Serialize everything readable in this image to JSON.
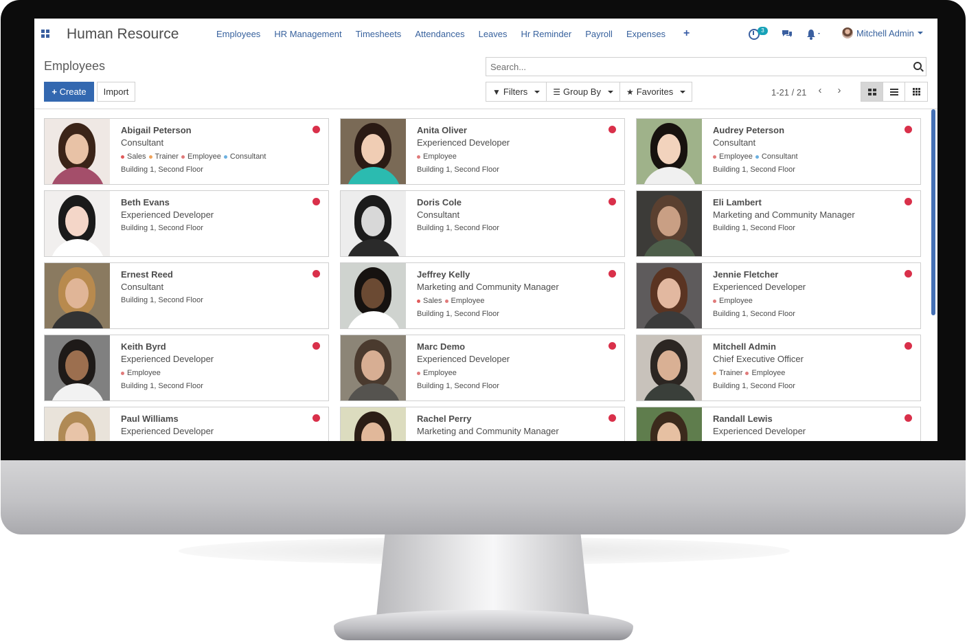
{
  "app": {
    "brand": "Human Resource",
    "menu": [
      "Employees",
      "HR Management",
      "Timesheets",
      "Attendances",
      "Leaves",
      "Hr Reminder",
      "Payroll",
      "Expenses"
    ],
    "add_menu_glyph": "+",
    "activity_count": "3",
    "user_name": "Mitchell Admin"
  },
  "control_panel": {
    "breadcrumb": "Employees",
    "create_label": "Create",
    "import_label": "Import",
    "search_placeholder": "Search...",
    "filters_label": "Filters",
    "group_by_label": "Group By",
    "favorites_label": "Favorites",
    "pager": "1-21 / 21",
    "active_view": "kanban"
  },
  "tag_colors": {
    "Sales": "#e15a5a",
    "Trainer": "#f0a35a",
    "Employee": "#e07a7a",
    "Consultant": "#6bb0e0"
  },
  "status_color": "#d9304a",
  "employees": [
    {
      "name": "Abigail Peterson",
      "job": "Consultant",
      "tags": [
        "Sales",
        "Trainer",
        "Employee",
        "Consultant"
      ],
      "location": "Building 1, Second Floor"
    },
    {
      "name": "Anita Oliver",
      "job": "Experienced Developer",
      "tags": [
        "Employee"
      ],
      "location": "Building 1, Second Floor"
    },
    {
      "name": "Audrey Peterson",
      "job": "Consultant",
      "tags": [
        "Employee",
        "Consultant"
      ],
      "location": "Building 1, Second Floor"
    },
    {
      "name": "Beth Evans",
      "job": "Experienced Developer",
      "tags": [],
      "location": "Building 1, Second Floor"
    },
    {
      "name": "Doris Cole",
      "job": "Consultant",
      "tags": [],
      "location": "Building 1, Second Floor"
    },
    {
      "name": "Eli Lambert",
      "job": "Marketing and Community Manager",
      "tags": [],
      "location": "Building 1, Second Floor"
    },
    {
      "name": "Ernest Reed",
      "job": "Consultant",
      "tags": [],
      "location": "Building 1, Second Floor"
    },
    {
      "name": "Jeffrey Kelly",
      "job": "Marketing and Community Manager",
      "tags": [
        "Sales",
        "Employee"
      ],
      "location": "Building 1, Second Floor"
    },
    {
      "name": "Jennie Fletcher",
      "job": "Experienced Developer",
      "tags": [
        "Employee"
      ],
      "location": "Building 1, Second Floor"
    },
    {
      "name": "Keith Byrd",
      "job": "Experienced Developer",
      "tags": [
        "Employee"
      ],
      "location": "Building 1, Second Floor"
    },
    {
      "name": "Marc Demo",
      "job": "Experienced Developer",
      "tags": [
        "Employee"
      ],
      "location": "Building 1, Second Floor"
    },
    {
      "name": "Mitchell Admin",
      "job": "Chief Executive Officer",
      "tags": [
        "Trainer",
        "Employee"
      ],
      "location": "Building 1, Second Floor"
    },
    {
      "name": "Paul Williams",
      "job": "Experienced Developer",
      "tags": [],
      "location": ""
    },
    {
      "name": "Rachel Perry",
      "job": "Marketing and Community Manager",
      "tags": [],
      "location": ""
    },
    {
      "name": "Randall Lewis",
      "job": "Experienced Developer",
      "tags": [],
      "location": ""
    }
  ]
}
